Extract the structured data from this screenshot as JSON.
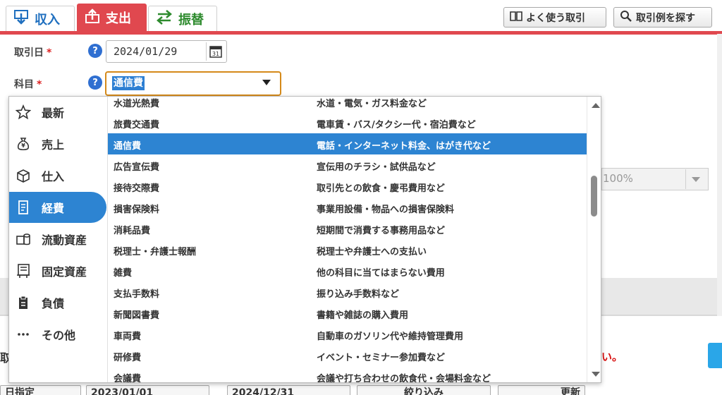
{
  "tabs": {
    "income": "収入",
    "expense": "支出",
    "transfer": "振替"
  },
  "top_buttons": {
    "favorites": "よく使う取引",
    "search_examples": "取引例を探す"
  },
  "form": {
    "date_label": "取引日",
    "date_value": "2024/01/29",
    "account_label": "科目",
    "account_value": "通信費",
    "required_mark": "*",
    "help_mark": "?"
  },
  "dropdown": {
    "categories": [
      {
        "label": "最新",
        "icon": "star-icon"
      },
      {
        "label": "売上",
        "icon": "money-bag-icon"
      },
      {
        "label": "仕入",
        "icon": "box-icon"
      },
      {
        "label": "経費",
        "icon": "receipt-icon",
        "active": true
      },
      {
        "label": "流動資産",
        "icon": "coins-icon"
      },
      {
        "label": "固定資産",
        "icon": "building-icon"
      },
      {
        "label": "負債",
        "icon": "clipboard-icon"
      },
      {
        "label": "その他",
        "icon": "more-icon"
      }
    ],
    "items": [
      {
        "name": "水道光熱費",
        "desc": "水道・電気・ガス料金など"
      },
      {
        "name": "旅費交通費",
        "desc": "電車賃・バス/タクシー代・宿泊費など"
      },
      {
        "name": "通信費",
        "desc": "電話・インターネット料金、はがき代など",
        "selected": true
      },
      {
        "name": "広告宣伝費",
        "desc": "宣伝用のチラシ・試供品など"
      },
      {
        "name": "接待交際費",
        "desc": "取引先との飲食・慶弔費用など"
      },
      {
        "name": "損害保険料",
        "desc": "事業用設備・物品への損害保険料"
      },
      {
        "name": "消耗品費",
        "desc": "短期間で消費する事務用品など"
      },
      {
        "name": "税理士・弁護士報酬",
        "desc": "税理士や弁護士への支払い"
      },
      {
        "name": "雑費",
        "desc": "他の科目に当てはまらない費用"
      },
      {
        "name": "支払手数料",
        "desc": "振り込み手数料など"
      },
      {
        "name": "新聞図書費",
        "desc": "書籍や雑誌の購入費用"
      },
      {
        "name": "車両費",
        "desc": "自動車のガソリン代や維持管理費用"
      },
      {
        "name": "研修費",
        "desc": "イベント・セミナー参加費など"
      },
      {
        "name": "会議費",
        "desc": "会議や打ち合わせの飲食代・会場料金など"
      }
    ]
  },
  "background": {
    "rate_value": "100%",
    "left_char": "取",
    "red_notice": "い。",
    "bottom_bar": {
      "period": "日指定",
      "from_date": "2023/01/01",
      "to_date": "2024/12/31",
      "filter": "絞り込み",
      "refresh": "更新"
    }
  },
  "colors": {
    "accent_red": "#e0484f",
    "selection_blue": "#2d84d2",
    "help_blue": "#2f6fd1",
    "focus_orange": "#d58a1a"
  }
}
